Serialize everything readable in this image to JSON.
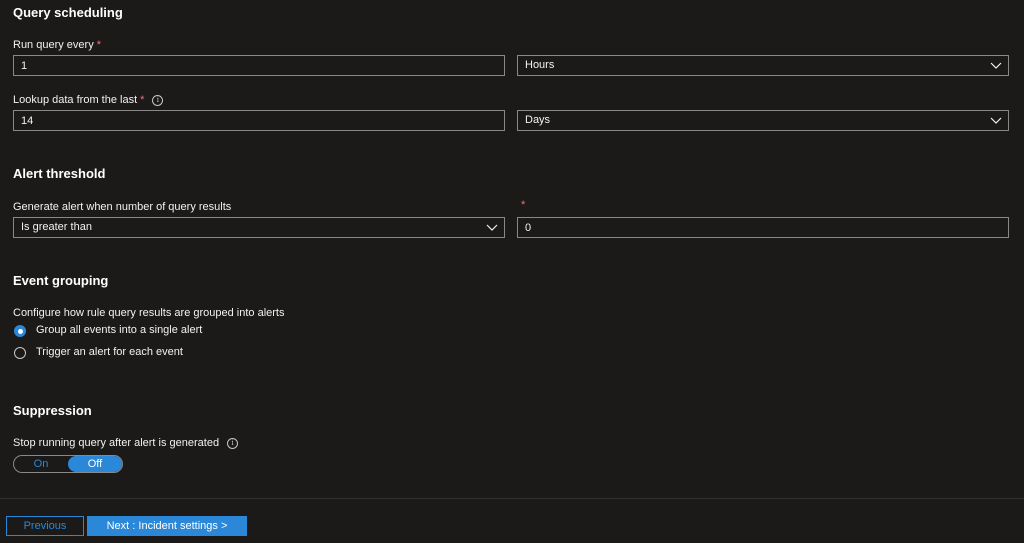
{
  "sections": {
    "query_scheduling": {
      "title": "Query scheduling",
      "run_every_label": "Run query every",
      "run_every_value": "1",
      "run_every_unit": "Hours",
      "lookup_label": "Lookup data from the last",
      "lookup_value": "14",
      "lookup_unit": "Days"
    },
    "alert_threshold": {
      "title": "Alert threshold",
      "generate_label": "Generate alert when number of query results",
      "operator": "Is greater than",
      "threshold_value": "0"
    },
    "event_grouping": {
      "title": "Event grouping",
      "description": "Configure how rule query results are grouped into alerts",
      "options": [
        "Group all events into a single alert",
        "Trigger an alert for each event"
      ],
      "selected_index": 0
    },
    "suppression": {
      "title": "Suppression",
      "stop_label": "Stop running query after alert is generated",
      "toggle_on": "On",
      "toggle_off": "Off",
      "selected": "Off"
    }
  },
  "required_marker": "*",
  "info_glyph": "i",
  "footer": {
    "previous_label": "Previous",
    "next_label": "Next : Incident settings >"
  },
  "colors": {
    "background": "#1b1a19",
    "accent": "#2b88d8",
    "required": "#f1707b",
    "border": "#8a8886"
  }
}
